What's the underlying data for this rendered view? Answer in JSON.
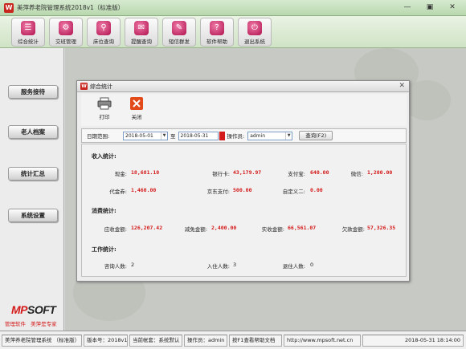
{
  "app": {
    "title": "美萍养老院管理系统2018v1（标准版）",
    "icon": "W"
  },
  "window": {
    "min_glyph": "—",
    "max_glyph": "▣",
    "close_glyph": "✕"
  },
  "toolbar": [
    {
      "label": "综合统计",
      "icon": "report-icon",
      "glyph": "☰"
    },
    {
      "label": "交班管理",
      "icon": "handover-icon",
      "glyph": "⚙"
    },
    {
      "label": "床位查询",
      "icon": "bed-search-icon",
      "glyph": "⚲"
    },
    {
      "label": "提醒查询",
      "icon": "reminder-icon",
      "glyph": "✉"
    },
    {
      "label": "短信群发",
      "icon": "sms-icon",
      "glyph": "✎"
    },
    {
      "label": "软件帮助",
      "icon": "help-icon",
      "glyph": "?"
    },
    {
      "label": "退出系统",
      "icon": "exit-icon",
      "glyph": "⏻"
    }
  ],
  "sidebar": [
    {
      "label": "服务接待"
    },
    {
      "label": "老人档案"
    },
    {
      "label": "统计汇总"
    },
    {
      "label": "系统设置"
    }
  ],
  "logo": {
    "text_red": "MP",
    "text_black": "SOFT",
    "tagline": "管理软件 美萍是专家"
  },
  "dialog": {
    "title": "综合统计",
    "icon": "W",
    "close_glyph": "✕",
    "tools": {
      "print": "打印",
      "close": "关闭"
    },
    "filter": {
      "date_label": "日期范围:",
      "date_from": "2018-05-01",
      "to_label": "至",
      "date_to": "2018-05-31",
      "operator_label": "操作员:",
      "operator": "admin",
      "query_button": "查询(F2)"
    },
    "income": {
      "heading": "收入统计:",
      "cash_label": "现金:",
      "cash": "18,681.10",
      "bank_label": "银行卡:",
      "bank": "43,179.97",
      "alipay_label": "支付宝:",
      "alipay": "640.00",
      "wechat_label": "微信:",
      "wechat": "1,200.00",
      "voucher_label": "代金券:",
      "voucher": "1,460.00",
      "jd_label": "京东支付:",
      "jd": "500.00",
      "custom_label": "自定义二:",
      "custom": "0.00"
    },
    "consume": {
      "heading": "消费统计:",
      "receivable_label": "应收金额:",
      "receivable": "126,207.42",
      "discount_label": "减免金额:",
      "discount": "2,400.00",
      "received_label": "实收金额:",
      "received": "66,561.07",
      "owed_label": "欠款金额:",
      "owed": "57,326.35"
    },
    "work": {
      "heading": "工作统计:",
      "consult_label": "咨询人数:",
      "consult": "2",
      "checkin_label": "入住人数:",
      "checkin": "3",
      "checkout_label": "退住人数:",
      "checkout": "0"
    }
  },
  "status": {
    "app_name": "美萍养老院管理系统 （标准版）",
    "version": "版本号：2018v1",
    "account": "当前帐套：系统默认",
    "operator": "操作员：admin",
    "help": "按F1查看帮助文档",
    "url": "http://www.mpsoft.net.cn",
    "datetime": "2018-05-31  18:14:00"
  },
  "colors": {
    "accent_red": "#d41a1a",
    "toolbar_green": "#cfe3c5"
  }
}
